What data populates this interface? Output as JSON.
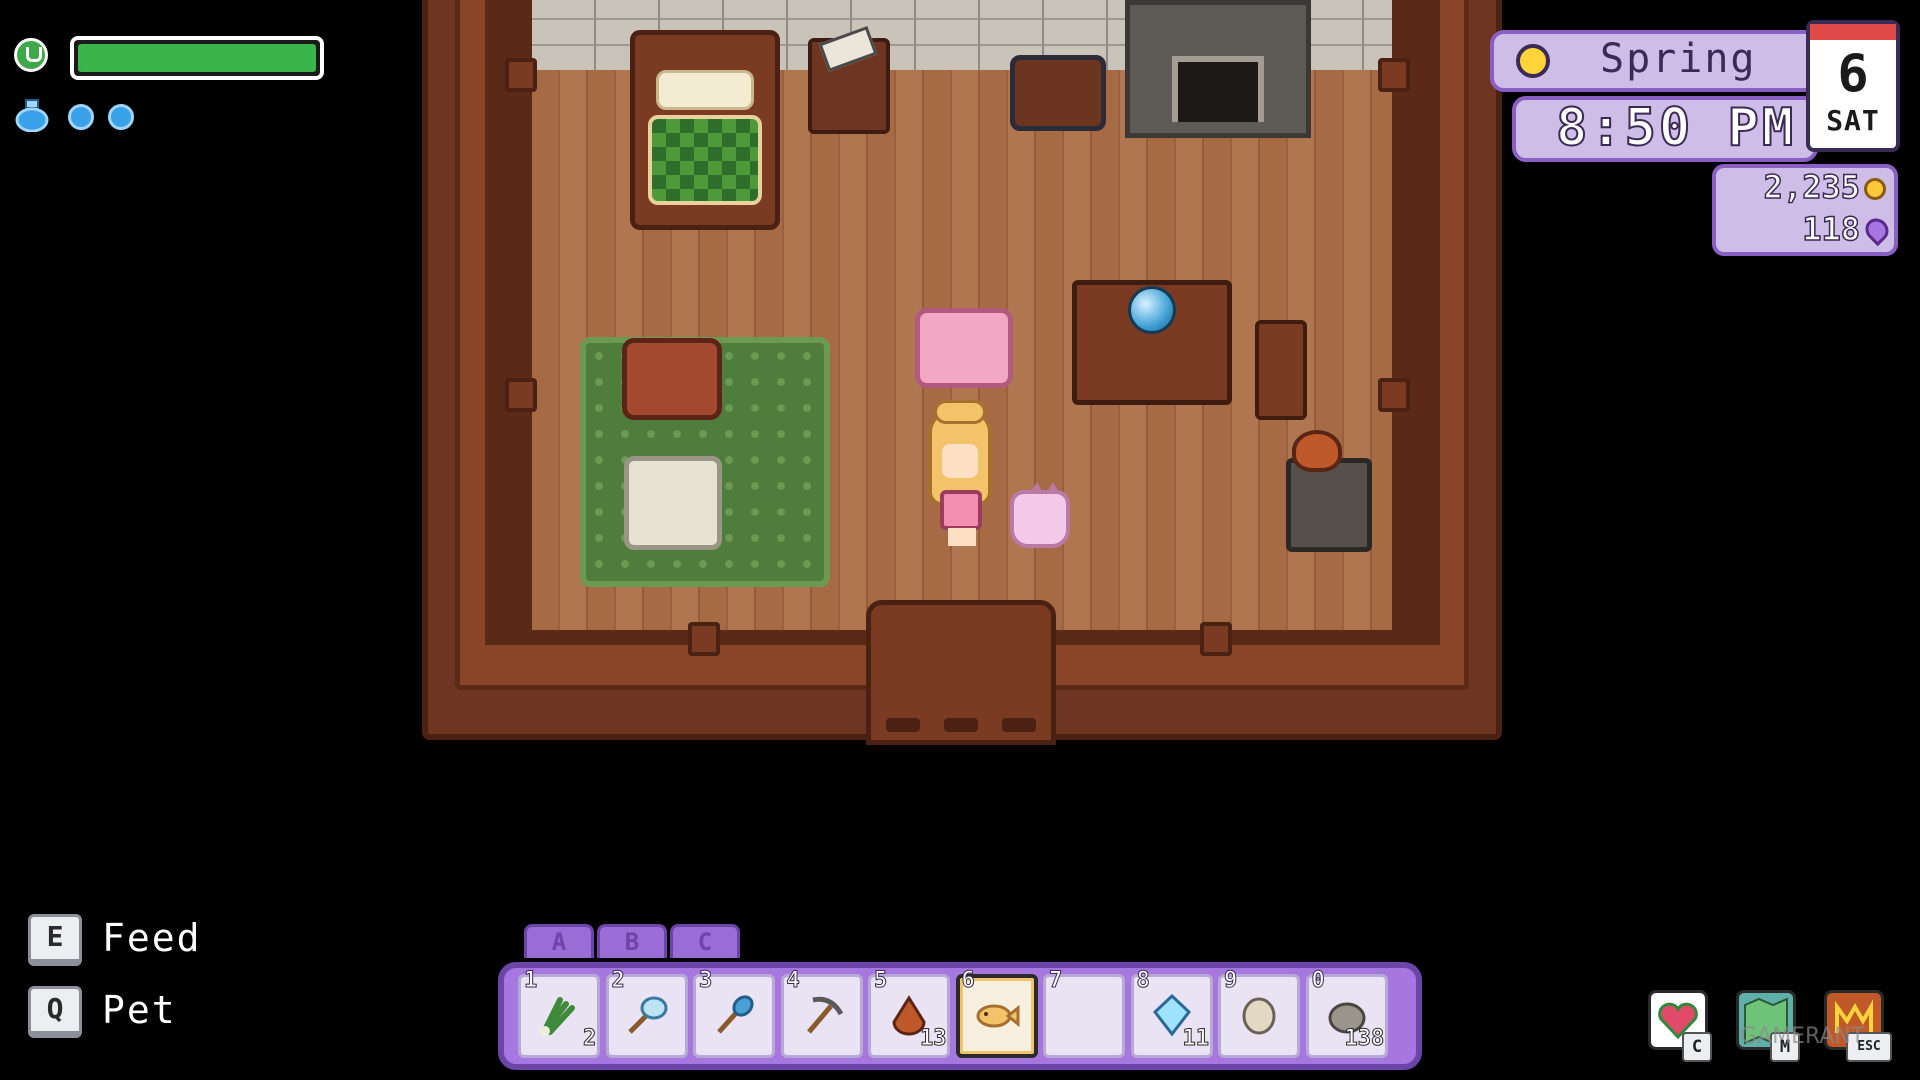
{
  "status": {
    "stamina_percent": 100,
    "mana_orbs": 2
  },
  "calendar": {
    "season": "Spring",
    "time": "8:50 PM",
    "day": "6",
    "weekday": "SAT"
  },
  "currency": {
    "gold": "2,235",
    "essence": "118"
  },
  "prompts": [
    {
      "key": "E",
      "action": "Feed"
    },
    {
      "key": "Q",
      "action": "Pet"
    }
  ],
  "hotbar": {
    "tabs": [
      "A",
      "B",
      "C"
    ],
    "selected_slot": "6",
    "slots": [
      {
        "number": "1",
        "item": "leek-icon",
        "count": "2"
      },
      {
        "number": "2",
        "item": "net-icon",
        "count": ""
      },
      {
        "number": "3",
        "item": "shovel-icon",
        "count": ""
      },
      {
        "number": "4",
        "item": "pickaxe-icon",
        "count": ""
      },
      {
        "number": "5",
        "item": "meat-icon",
        "count": "13"
      },
      {
        "number": "6",
        "item": "fish-treat-icon",
        "count": ""
      },
      {
        "number": "7",
        "item": "",
        "count": ""
      },
      {
        "number": "8",
        "item": "crystal-icon",
        "count": "11"
      },
      {
        "number": "9",
        "item": "stone-egg-icon",
        "count": ""
      },
      {
        "number": "0",
        "item": "rock-icon",
        "count": "138"
      }
    ]
  },
  "menu_shortcuts": [
    {
      "key": "C",
      "icon": "relationships-heart-icon"
    },
    {
      "key": "M",
      "icon": "map-icon"
    },
    {
      "key": "ESC",
      "icon": "menu-icon"
    }
  ],
  "watermark": "GAMERANT",
  "colors": {
    "stamina": "#39b54a",
    "mana": "#3aa0e8",
    "hud_panel": "#cdbde7",
    "hud_border": "#8a5fc4",
    "hotbar": "#a777e0"
  }
}
